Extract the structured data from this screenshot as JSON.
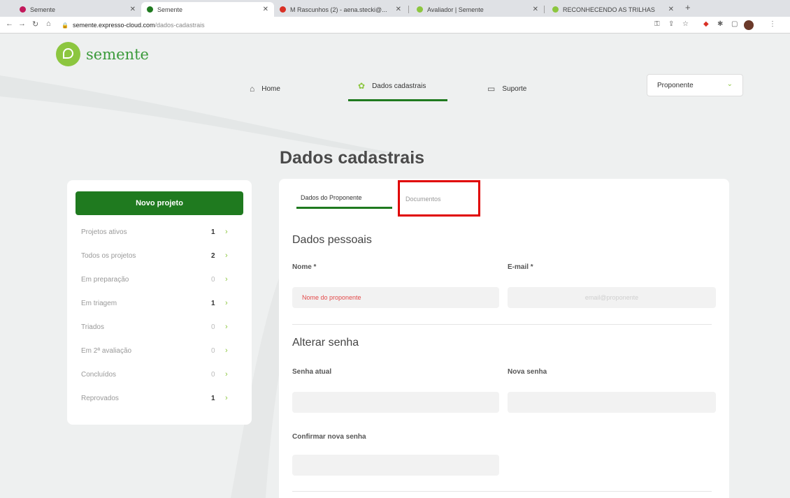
{
  "browser": {
    "tabs": [
      {
        "title": "Semente",
        "color": "#c2185b"
      },
      {
        "title": "Semente",
        "color": "#1f7a1f"
      },
      {
        "title": "M Rascunhos (2) - aena.stecki@...",
        "color": "#d93025"
      },
      {
        "title": "Avaliador | Semente",
        "color": "#8cc63f"
      },
      {
        "title": "RECONHECENDO AS TRILHAS",
        "color": "#8cc63f"
      }
    ],
    "url_host": "semente.expresso-cloud.com",
    "url_path": "/dados-cadastrais"
  },
  "app": {
    "logo": "semente",
    "nav": [
      {
        "label": "Home",
        "icon": "home-icon"
      },
      {
        "label": "Dados cadastrais",
        "icon": "gear-icon"
      },
      {
        "label": "Suporte",
        "icon": "chat-icon"
      }
    ],
    "role_select": "Proponente",
    "page_title": "Dados cadastrais",
    "accent": "#1f7a1f",
    "accent_light": "#8cc63f"
  },
  "sidebar": {
    "new_project": "Novo projeto",
    "items": [
      {
        "label": "Projetos ativos",
        "count": "1"
      },
      {
        "label": "Todos os projetos",
        "count": "2"
      },
      {
        "label": "Em preparação",
        "count": "0"
      },
      {
        "label": "Em triagem",
        "count": "1"
      },
      {
        "label": "Triados",
        "count": "0"
      },
      {
        "label": "Em 2ª avaliação",
        "count": "0"
      },
      {
        "label": "Concluídos",
        "count": "0"
      },
      {
        "label": "Reprovados",
        "count": "1"
      }
    ]
  },
  "main": {
    "tabs": [
      {
        "label": "Dados do Proponente"
      },
      {
        "label": "Documentos"
      }
    ],
    "personal": {
      "title": "Dados pessoais",
      "name_label": "Nome *",
      "name_value": "Nome do proponente",
      "email_label": "E-mail *",
      "email_value": "email@proponente"
    },
    "password": {
      "title": "Alterar senha",
      "current_label": "Senha atual",
      "new_label": "Nova senha",
      "confirm_label": "Confirmar nova senha"
    }
  }
}
